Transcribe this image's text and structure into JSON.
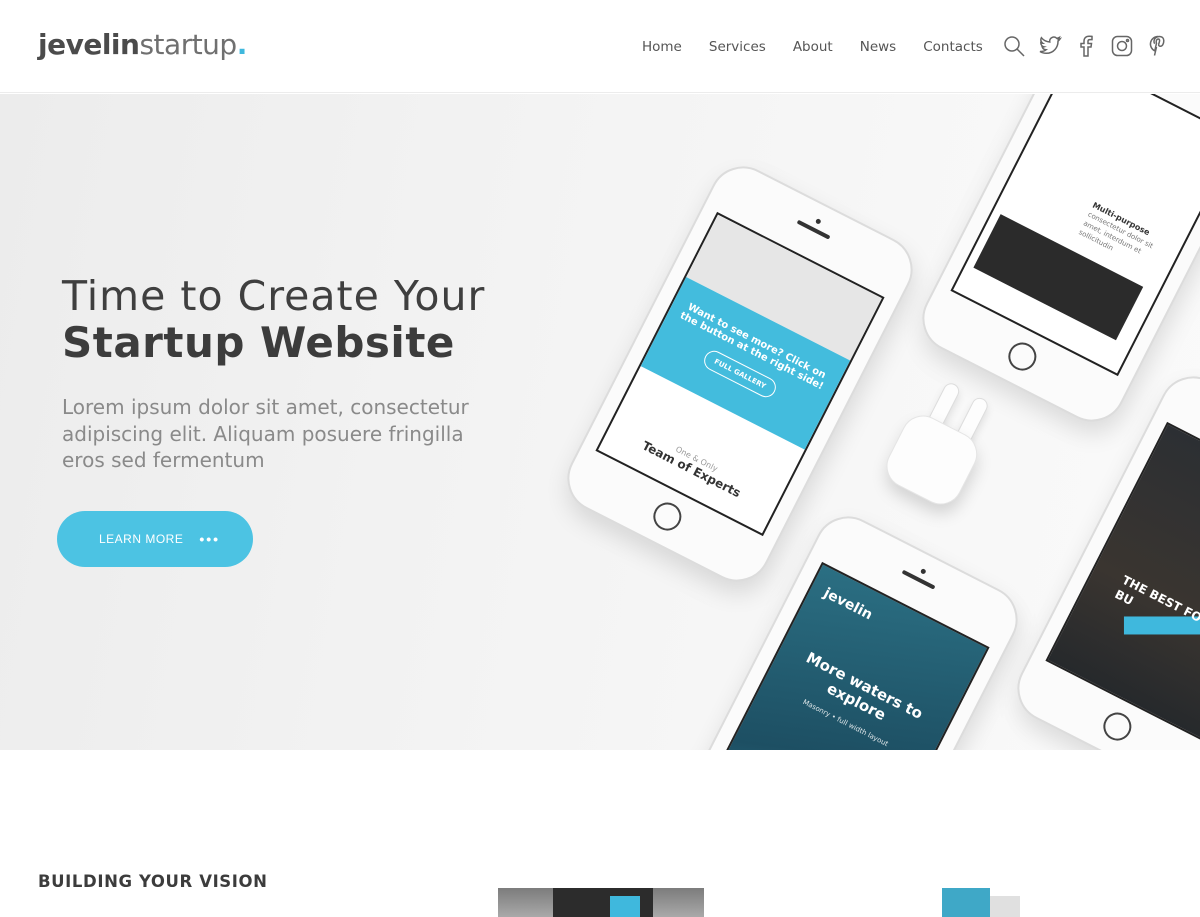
{
  "header": {
    "logo_bold": "jevelin",
    "logo_light": "startup",
    "logo_dot": ".",
    "nav": [
      "Home",
      "Services",
      "About",
      "News",
      "Contacts"
    ],
    "icons": [
      "search-icon",
      "twitter-icon",
      "facebook-icon",
      "instagram-icon",
      "pinterest-icon"
    ]
  },
  "hero": {
    "title_light": "Time to Create Your",
    "title_bold": "Startup Website",
    "text": "Lorem ipsum dolor sit amet, consectetur adipiscing elit. Aliquam posuere fringilla eros sed fermentum",
    "button_label": "LEARN MORE",
    "button_dots": "•••"
  },
  "phones": {
    "p1_blue": "Want to see more? Click on the button at the right side!",
    "p1_gallery": "FULL GALLERY",
    "p1_team_small": "One & Only",
    "p1_team": "Team of Experts",
    "p2_heading": "Multi-purpose",
    "p2_text": "consectetur dolor sit amet, interdum et sollicitudin",
    "p3_brand": "jevelin",
    "p3_msg": "More waters to explore",
    "p3_sub": "Masonry • full width layout",
    "p4_best": "THE BEST FOR YOUR BU"
  },
  "section": {
    "heading": "BUILDING YOUR VISION"
  },
  "colors": {
    "accent": "#4cc3e3",
    "text": "#3c3c3c"
  }
}
